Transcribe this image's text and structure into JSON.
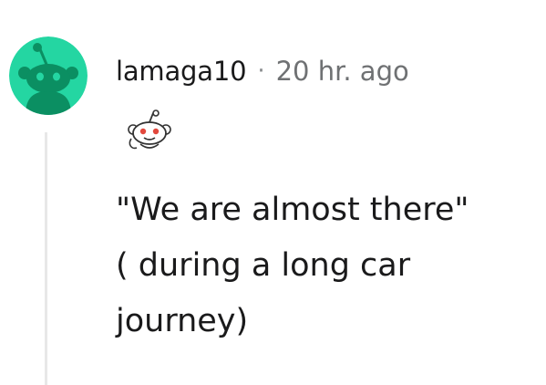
{
  "comment": {
    "username": "lamaga10",
    "separator": "·",
    "timestamp": "20 hr. ago",
    "body_lines": [
      "\"We are almost there\"",
      "( during a long car",
      "journey)"
    ]
  },
  "avatar": {
    "icon": "snoo-avatar-icon",
    "background_color": "#24d6a2",
    "figure_color": "#0b8f62"
  },
  "award": {
    "icon": "snoo-award-icon"
  },
  "colors": {
    "text": "#1a1a1b",
    "meta": "#6f7173",
    "thread_line": "#e8e8e8"
  }
}
